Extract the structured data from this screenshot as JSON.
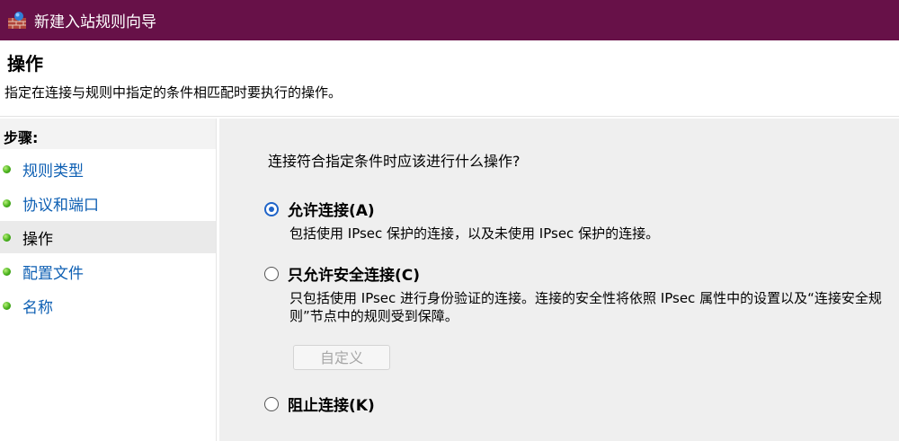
{
  "window": {
    "title": "新建入站规则向导",
    "title_bar_color": "#671148",
    "icon": "firewall-wizard-icon"
  },
  "header": {
    "title": "操作",
    "description": "指定在连接与规则中指定的条件相匹配时要执行的操作。"
  },
  "steps": {
    "heading": "步骤:",
    "items": [
      {
        "label": "规则类型",
        "current": false
      },
      {
        "label": "协议和端口",
        "current": false
      },
      {
        "label": "操作",
        "current": true
      },
      {
        "label": "配置文件",
        "current": false
      },
      {
        "label": "名称",
        "current": false
      }
    ]
  },
  "main": {
    "question": "连接符合指定条件时应该进行什么操作?",
    "options": [
      {
        "label": "允许连接(A)",
        "selected": true,
        "description": "包括使用 IPsec 保护的连接，以及未使用 IPsec 保护的连接。"
      },
      {
        "label": "只允许安全连接(C)",
        "selected": false,
        "description": "只包括使用 IPsec 进行身份验证的连接。连接的安全性将依照 IPsec 属性中的设置以及“连接安全规则”节点中的规则受到保障。"
      },
      {
        "label": "阻止连接(K)",
        "selected": false,
        "description": ""
      }
    ],
    "custom_button_label": "自定义"
  },
  "colors": {
    "link": "#0d5fb3",
    "radio_selected": "#1f64c8",
    "step_indicator": "#47b11b"
  }
}
